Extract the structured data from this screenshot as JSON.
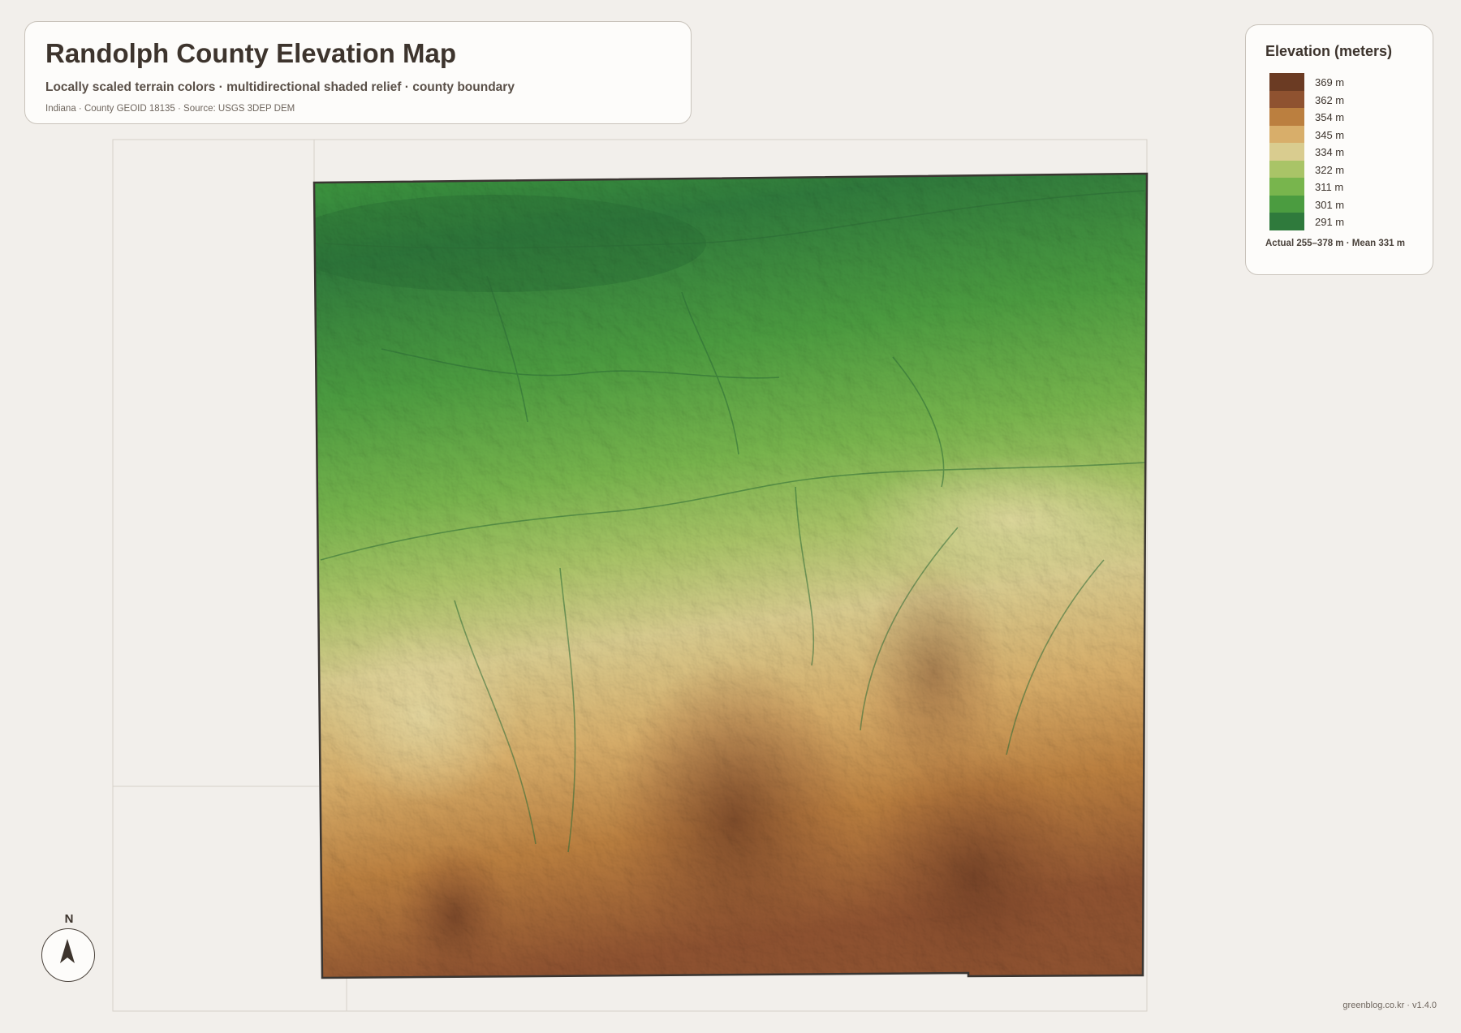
{
  "header": {
    "title": "Randolph County Elevation Map",
    "subtitle": "Locally scaled terrain colors · multidirectional shaded relief · county boundary",
    "source": "Indiana · County GEOID 18135 · Source: USGS 3DEP DEM"
  },
  "legend": {
    "title": "Elevation (meters)",
    "entries": [
      {
        "label": "369 m",
        "value": 369,
        "color": "#6b3b23"
      },
      {
        "label": "362 m",
        "value": 362,
        "color": "#8f5230"
      },
      {
        "label": "354 m",
        "value": 354,
        "color": "#bb7f3f"
      },
      {
        "label": "345 m",
        "value": 345,
        "color": "#d8ae6a"
      },
      {
        "label": "334 m",
        "value": 334,
        "color": "#d9cc8f"
      },
      {
        "label": "322 m",
        "value": 322,
        "color": "#a9c467"
      },
      {
        "label": "311 m",
        "value": 311,
        "color": "#78b54d"
      },
      {
        "label": "301 m",
        "value": 301,
        "color": "#4b9c40"
      },
      {
        "label": "291 m",
        "value": 291,
        "color": "#2f7a3c"
      }
    ],
    "stats": "Actual 255–378 m · Mean 331 m"
  },
  "compass": {
    "label": "N",
    "icon": "north-arrow-icon"
  },
  "footer": {
    "credit": "greenblog.co.kr · v1.4.0"
  }
}
